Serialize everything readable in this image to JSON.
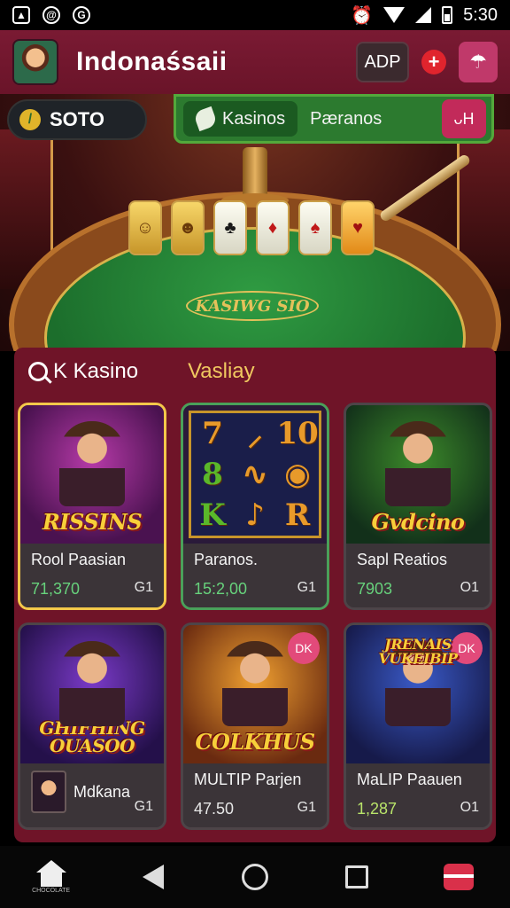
{
  "status_bar": {
    "left_icons": [
      "image-icon",
      "at-icon",
      "sync-icon"
    ],
    "time": "5:30"
  },
  "header": {
    "title": "Indonaśsaii",
    "adp_label": "ADP",
    "plus_label": "+",
    "umbrella_label": "☂"
  },
  "hero": {
    "coins_value": "SOTO",
    "tabs": [
      {
        "label": "Kasinos"
      },
      {
        "label": "Pæranos"
      }
    ],
    "extra_label": "ᴗH",
    "table_logo": "KASIWG SIO"
  },
  "section_tabs": {
    "active_label": "K Kasino",
    "inactive_label": "Vasliay"
  },
  "games": [
    {
      "art_text": "RISSINS",
      "title": "Rool Paasian",
      "value": "71,370",
      "meta": "G1"
    },
    {
      "art_text": "",
      "title": "Paranos.",
      "value": "15:2,00",
      "meta": "G1",
      "slots": [
        "7",
        "⸝",
        "10",
        "8",
        "∿",
        "◉",
        "K",
        "♪",
        "R"
      ]
    },
    {
      "art_text": "Gvdcino",
      "title": "Sapl Reatios",
      "value": "7903",
      "meta": "O1"
    },
    {
      "art_text": "GHIFHING OUASOO",
      "title": "Mdƙana",
      "value": "",
      "meta": "G1"
    },
    {
      "art_text": "COLKHUS",
      "title": "MULTIP Parjen",
      "value": "47.50",
      "meta": "G1",
      "badge": "DK"
    },
    {
      "art_text": "JRENAIS VUKEIBIP",
      "title": "MaLIP Paauen",
      "value": "1,287",
      "meta": "O1",
      "badge": "DK"
    }
  ],
  "colors": {
    "header": "#7a1a33",
    "panel": "#6f1428",
    "felt": "#2f9b42",
    "accent_green": "#67d27c",
    "accent_gold": "#f0c860"
  },
  "nav": {
    "home_label": "CHOCOLATE"
  }
}
